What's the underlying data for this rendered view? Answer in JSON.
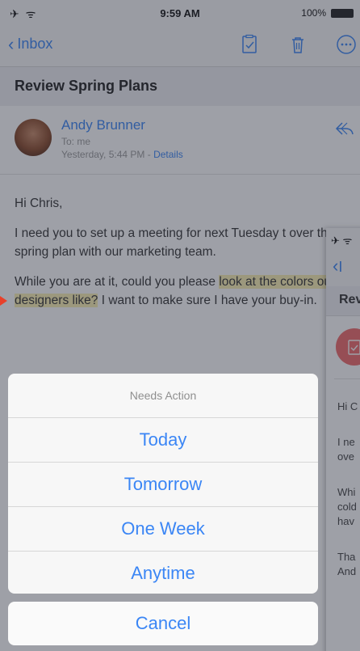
{
  "status_bar": {
    "left": "✈ ᯤ",
    "time": "9:59 AM",
    "battery": "100%"
  },
  "nav": {
    "back_label": "Inbox",
    "icons": [
      "checklist-icon",
      "trash-icon",
      "more-icon"
    ]
  },
  "email": {
    "subject": "Review Spring Plans",
    "sender": "Andy Brunner",
    "to": "To: me",
    "date": "Yesterday, 5:44 PM - ",
    "details_label": "Details",
    "greeting": "Hi Chris,",
    "p1": "I need you to set up a meeting for next Tuesday t over the spring plan with our marketing team.",
    "p2_start": "While you are at it, could you please ",
    "p2_highlight": "look at the colors our designers like?",
    "p2_end": " I want to make sure I have your buy-in."
  },
  "second_screen": {
    "status": "✈ ᯤ",
    "back_fragment": "I",
    "subject_fragment": "Rev",
    "lines": [
      "Hi C",
      "I ne",
      "ove",
      "Whi",
      "cold",
      "hav",
      "Tha",
      "And"
    ]
  },
  "action_sheet": {
    "title": "Needs Action",
    "options": [
      "Today",
      "Tomorrow",
      "One Week",
      "Anytime"
    ],
    "cancel_label": "Cancel"
  },
  "colors": {
    "accent": "#3b86f5",
    "highlight": "#fbf0b3",
    "badge": "#f06b6b",
    "arrow": "#e8402a"
  }
}
